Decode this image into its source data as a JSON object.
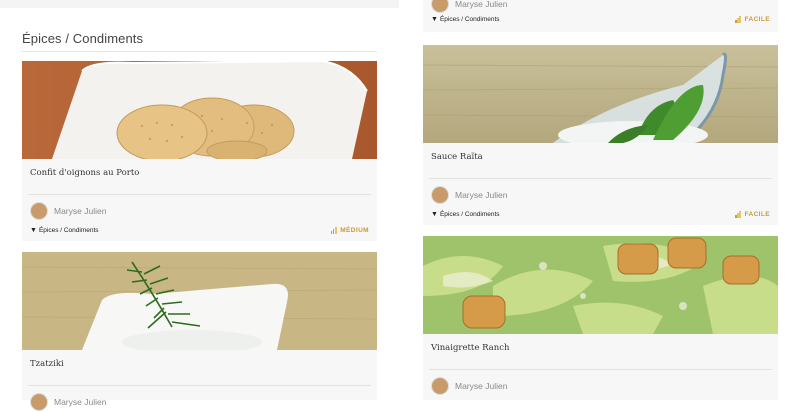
{
  "section_title": "Épices / Condiments",
  "cards": {
    "right_top": {
      "author": "Maryse Julien",
      "category": "Épices / Condiments",
      "difficulty": "FACILE"
    },
    "confit": {
      "title": "Confit d'oignons au Porto",
      "author": "Maryse Julien",
      "category": "Épices / Condiments",
      "difficulty": "MÉDIUM"
    },
    "raita": {
      "title": "Sauce Raïta",
      "author": "Maryse Julien",
      "category": "Épices / Condiments",
      "difficulty": "FACILE"
    },
    "tzatziki": {
      "title": "Tzatziki",
      "author": "Maryse Julien"
    },
    "ranch": {
      "title": "Vinaigrette Ranch",
      "author": "Maryse Julien"
    }
  },
  "icons": {
    "category": "filter-icon",
    "difficulty": "signal-bars-icon"
  },
  "colors": {
    "difficulty": "#c79a3c",
    "card_bg": "#f7f7f7"
  }
}
